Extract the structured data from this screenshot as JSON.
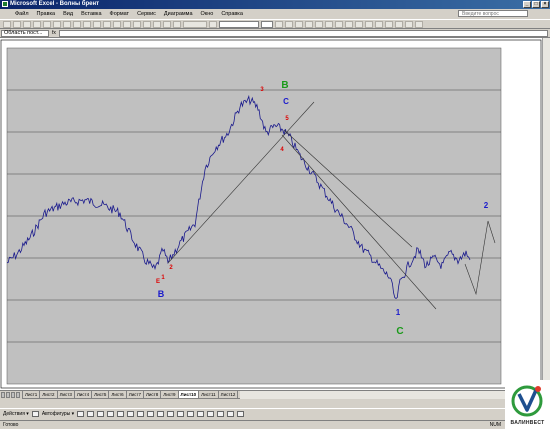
{
  "window": {
    "title": "Microsoft Excel - Волны брент",
    "controls": [
      "_",
      "□",
      "×"
    ]
  },
  "menu": {
    "items": [
      "Файл",
      "Правка",
      "Вид",
      "Вставка",
      "Формат",
      "Сервис",
      "Диаграмма",
      "Окно",
      "Справка"
    ],
    "ask_placeholder": "Введите вопрос"
  },
  "formula_bar": {
    "name_box": "Область пост...",
    "fx": "fx"
  },
  "sheet_tabs": {
    "items": [
      "Лист1",
      "Лист2",
      "Лист3",
      "Лист4",
      "Лист5",
      "Лист6",
      "Лист7",
      "Лист8",
      "Лист9",
      "Лист10",
      "Лист11",
      "Лист12",
      "Лист13",
      "Лист14",
      "Лист15",
      "Лист16",
      "Лист17"
    ],
    "active_index": 9
  },
  "drawing_toolbar": {
    "actions_label": "Действия ▾",
    "autoshapes_label": "Автофигуры ▾"
  },
  "status_bar": {
    "ready": "Готово",
    "num": "NUM"
  },
  "logo": {
    "name": "ВАЛИНВЕСТ"
  },
  "chart_data": {
    "type": "line",
    "gridlines": "horizontal",
    "plot_background": "#c0c0c0",
    "series_color": "#1a1a8c",
    "wave_labels": [
      {
        "text": "B",
        "color": "#1a9a1a"
      },
      {
        "text": "C",
        "color": "#1a1acc"
      },
      {
        "text": "3",
        "color": "#dd0000"
      },
      {
        "text": "5",
        "color": "#dd0000"
      },
      {
        "text": "4",
        "color": "#dd0000"
      },
      {
        "text": "1",
        "color": "#dd0000"
      },
      {
        "text": "2",
        "color": "#dd0000"
      },
      {
        "text": "E",
        "color": "#dd0000"
      },
      {
        "text": "B",
        "color": "#1a1acc"
      },
      {
        "text": "1",
        "color": "#1a1acc"
      },
      {
        "text": "C",
        "color": "#1a9a1a"
      },
      {
        "text": "2",
        "color": "#1a1acc"
      }
    ]
  }
}
